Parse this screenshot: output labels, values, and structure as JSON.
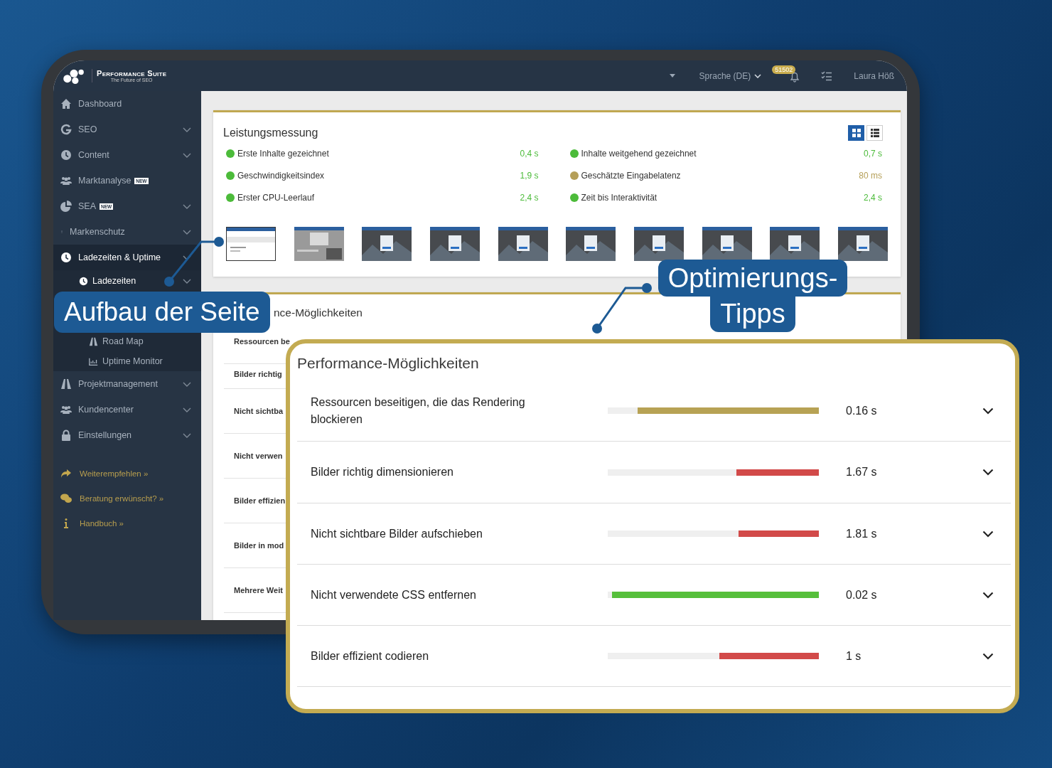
{
  "header": {
    "brand": "Performance Suite",
    "tagline": "The Future of SEO",
    "language": "Sprache (DE)",
    "notifications": "51502",
    "user": "Laura Höß"
  },
  "sidebar": {
    "items": [
      {
        "label": "Dashboard",
        "selected": false,
        "chevron": false
      },
      {
        "label": "SEO",
        "selected": false,
        "chevron": true
      },
      {
        "label": "Content",
        "selected": false,
        "chevron": true
      },
      {
        "label": "Marktanalyse",
        "badge": "NEW",
        "selected": false,
        "chevron": false
      },
      {
        "label": "SEA",
        "badge": "NEW",
        "selected": false,
        "chevron": true
      },
      {
        "label": "Markenschutz",
        "selected": false,
        "chevron": true
      },
      {
        "label": "Ladezeiten & Uptime",
        "selected": true,
        "chevron": true,
        "children": [
          {
            "label": "Ladezeiten",
            "selected": true,
            "chevron": true
          },
          {
            "label": "Road Map",
            "selected": false,
            "chevron": false
          },
          {
            "label": "Uptime Monitor",
            "selected": false,
            "chevron": false
          }
        ]
      },
      {
        "label": "Projektmanagement",
        "selected": false,
        "chevron": true
      },
      {
        "label": "Kundencenter",
        "selected": false,
        "chevron": true
      },
      {
        "label": "Einstellungen",
        "selected": false,
        "chevron": true
      }
    ],
    "links": [
      "Weiterempfehlen »",
      "Beratung erwünscht? »",
      "Handbuch »"
    ]
  },
  "performance": {
    "title": "Leistungsmessung",
    "view_toggle": [
      {
        "kind": "grid",
        "selected": true
      },
      {
        "kind": "list",
        "selected": false
      }
    ],
    "metrics": [
      {
        "label": "Erste Inhalte gezeichnet",
        "value": "0,4 s",
        "color": "#4cbb3a"
      },
      {
        "label": "Inhalte weitgehend gezeichnet",
        "value": "0,7 s",
        "color": "#4cbb3a"
      },
      {
        "label": "Geschwindigkeitsindex",
        "value": "1,9 s",
        "color": "#4cbb3a"
      },
      {
        "label": "Geschätzte Eingabelatenz",
        "value": "80 ms",
        "color": "#b59f58"
      },
      {
        "label": "Erster CPU-Leerlauf",
        "value": "2,4 s",
        "color": "#4cbb3a"
      },
      {
        "label": "Zeit bis Interaktivität",
        "value": "2,4 s",
        "color": "#4cbb3a"
      }
    ]
  },
  "opportunities_panel": {
    "title": "nce-Möglichkeiten",
    "rows": [
      "Ressourcen be",
      "Bilder richtig",
      "Nicht sichtba",
      "Nicht verwen",
      "Bilder effizien",
      "Bilder in mod",
      "Mehrere Weit"
    ]
  },
  "callouts": [
    {
      "lines": [
        "Aufbau der Seite"
      ]
    },
    {
      "lines": [
        "Optimierungs-",
        "Tipps"
      ]
    }
  ],
  "opportunities": {
    "title": "Performance-Möglichkeiten",
    "rows": [
      {
        "label": "Ressourcen beseitigen, die das Rendering blockieren",
        "value": "0.16 s",
        "level": 0.86,
        "color": "#b7a254"
      },
      {
        "label": "Bilder richtig dimensionieren",
        "value": "1.67 s",
        "level": 0.39,
        "color": "#d24a49"
      },
      {
        "label": "Nicht sichtbare Bilder aufschieben",
        "value": "1.81 s",
        "level": 0.38,
        "color": "#d24a49"
      },
      {
        "label": "Nicht verwendete CSS entfernen",
        "value": "0.02 s",
        "level": 0.98,
        "color": "#56bf3b"
      },
      {
        "label": "Bilder effizient codieren",
        "value": "1 s",
        "level": 0.47,
        "color": "#d24a49"
      }
    ]
  }
}
